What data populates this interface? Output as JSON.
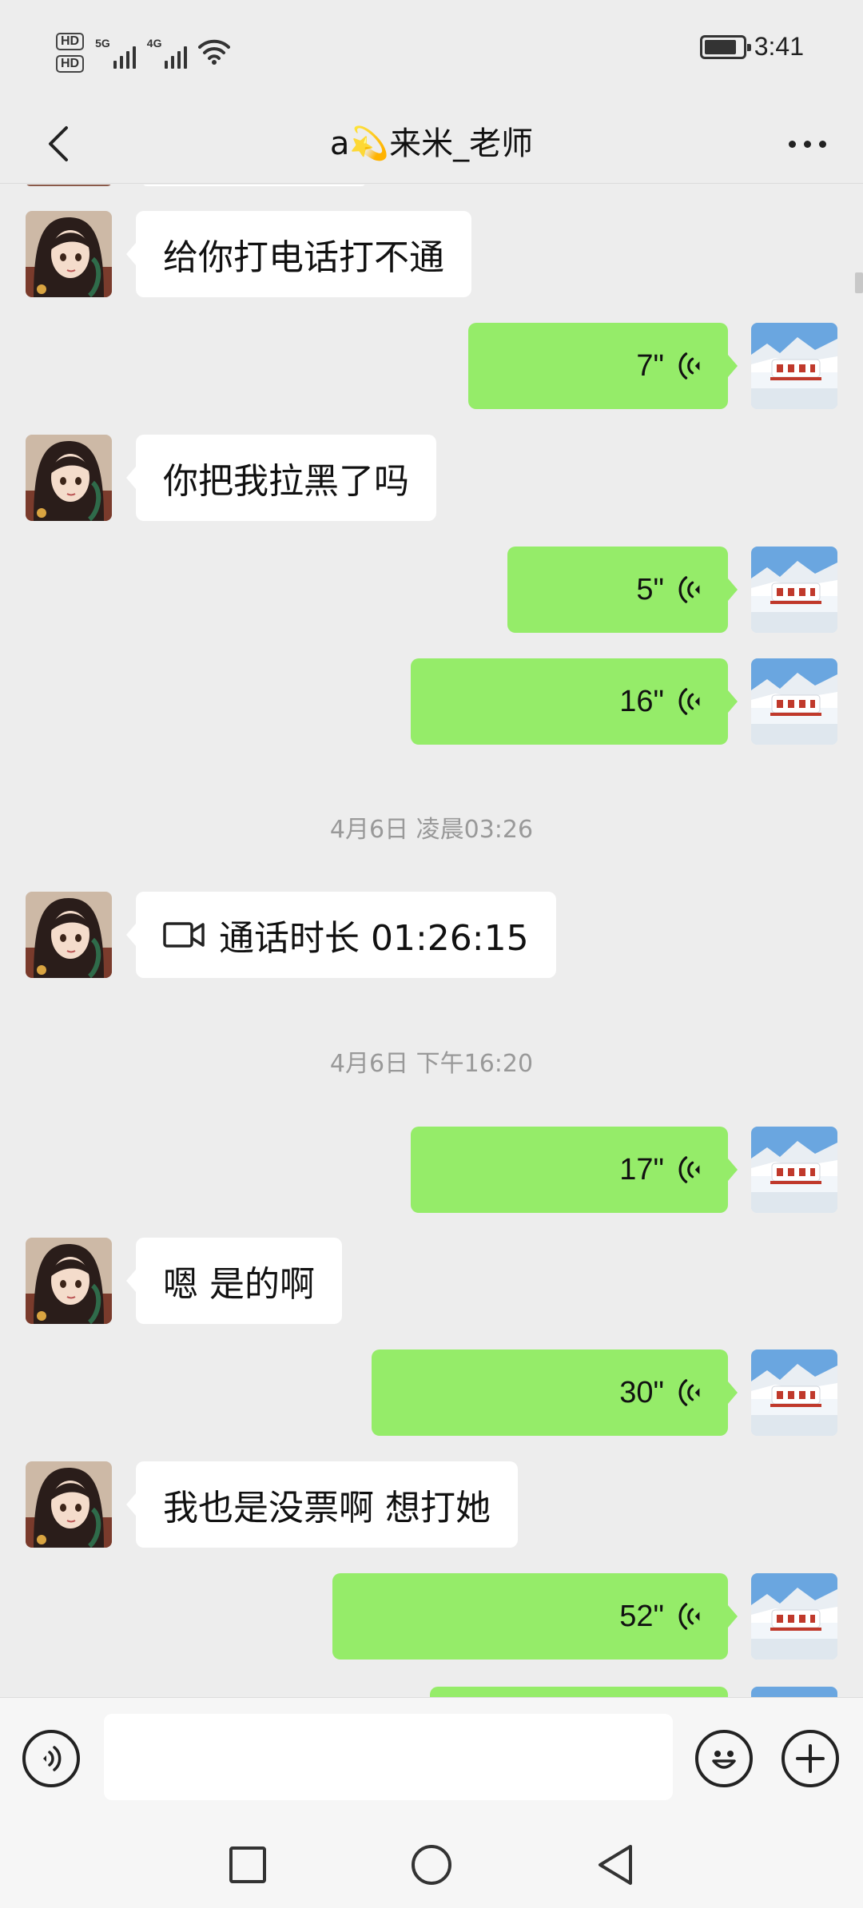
{
  "status_bar": {
    "hd1": "HD",
    "hd2": "HD",
    "net1": "5G",
    "net2": "4G",
    "time": "3:41",
    "battery_level": 0.85
  },
  "header": {
    "title": "a💫来米_老师",
    "back_icon": "chevron-left-icon",
    "more_icon": "more-dots-icon"
  },
  "messages": {
    "m1": {
      "sender": "contact",
      "type": "text",
      "text": "给你打电话打不通"
    },
    "m2": {
      "sender": "me",
      "type": "voice",
      "duration": "7\""
    },
    "m3": {
      "sender": "contact",
      "type": "text",
      "text": "你把我拉黑了吗"
    },
    "m4": {
      "sender": "me",
      "type": "voice",
      "duration": "5\""
    },
    "m5": {
      "sender": "me",
      "type": "voice",
      "duration": "16\""
    },
    "ts1": "4月6日 凌晨03:26",
    "m6": {
      "sender": "contact",
      "type": "video-call",
      "text": "通话时长 01:26:15"
    },
    "ts2": "4月6日 下午16:20",
    "m7": {
      "sender": "me",
      "type": "voice",
      "duration": "17\""
    },
    "m8": {
      "sender": "contact",
      "type": "text",
      "text": "嗯 是的啊"
    },
    "m9": {
      "sender": "me",
      "type": "voice",
      "duration": "30\""
    },
    "m10": {
      "sender": "contact",
      "type": "text",
      "text": "我也是没票啊 想打她"
    },
    "m11": {
      "sender": "me",
      "type": "voice",
      "duration": "52\""
    }
  },
  "input_bar": {
    "voice_icon": "voice-mode-icon",
    "input_value": "",
    "emoji_icon": "emoji-icon",
    "plus_icon": "plus-icon"
  },
  "nav_bar": {
    "recents_icon": "square-icon",
    "home_icon": "circle-icon",
    "back_icon": "triangle-back-icon"
  },
  "colors": {
    "background": "#ededed",
    "outgoing_bubble": "#95ec69",
    "incoming_bubble": "#ffffff",
    "timestamp": "#999999"
  }
}
